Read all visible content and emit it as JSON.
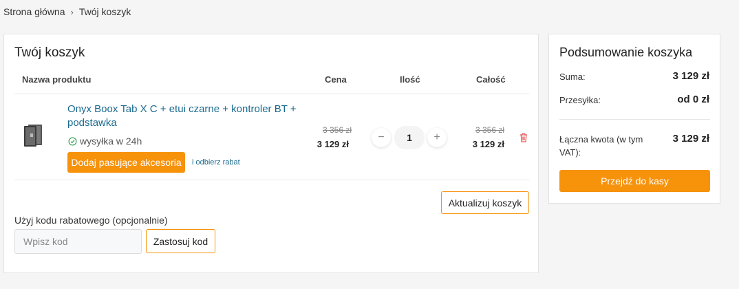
{
  "breadcrumb": {
    "home": "Strona główna",
    "separator": "›",
    "current": "Twój koszyk"
  },
  "cart": {
    "title": "Twój koszyk",
    "columns": {
      "product": "Nazwa produktu",
      "price": "Cena",
      "qty": "Ilość",
      "total": "Całość"
    },
    "item": {
      "name": "Onyx Boox Tab X C + etui czarne + kontroler BT + podstawka",
      "shipping": "wysyłka w 24h",
      "accessories_button": "Dodaj pasujące akcesoria",
      "discount_link": "i odbierz rabat",
      "old_price": "3 356 zł",
      "price": "3 129 zł",
      "quantity": "1",
      "old_total": "3 356 zł",
      "total": "3 129 zł"
    },
    "update_button": "Aktualizuj koszyk",
    "promo": {
      "label": "Użyj kodu rabatowego (opcjonalnie)",
      "placeholder": "Wpisz kod",
      "apply_button": "Zastosuj kod"
    }
  },
  "summary": {
    "title": "Podsumowanie koszyka",
    "subtotal_label": "Suma:",
    "subtotal_value": "3 129 zł",
    "shipping_label": "Przesyłka:",
    "shipping_value": "od 0 zł",
    "total_label": "Łączna kwota (w tym VAT):",
    "total_value": "3 129 zł",
    "checkout_button": "Przejdź do kasy"
  },
  "icons": {
    "ship": "check-circle-icon",
    "delete": "trash-icon",
    "minus": "minus-icon",
    "plus": "plus-icon"
  },
  "colors": {
    "accent": "#f7920b",
    "link": "#1a6a8e",
    "success": "#3aa35a",
    "danger": "#e03a3a"
  }
}
